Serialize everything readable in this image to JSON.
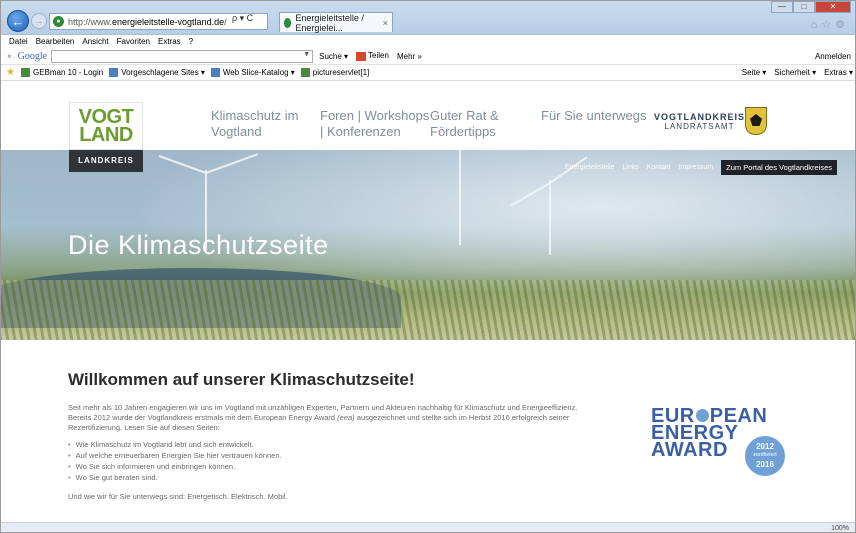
{
  "browser": {
    "url_prefix": "http://www.",
    "url_domain": "energieleitstelle-vogtland.de",
    "url_suffix": "/",
    "addr_tools": "ρ ▾ C",
    "tab_title": "Energieleitstelle / Energielei...",
    "tab_close": "×",
    "menu": [
      "Datei",
      "Bearbeiten",
      "Ansicht",
      "Favoriten",
      "Extras",
      "?"
    ],
    "search_provider": "Google",
    "search_button": "Suche ▾",
    "share_button": "Teilen",
    "more_button": "Mehr »",
    "signin": "Anmelden",
    "favorites": [
      "GEBman 10 - Login",
      "Vorgeschlagene Sites ▾",
      "Web Slice-Katalog ▾",
      "pictureservlet[1]"
    ],
    "command_bar": [
      "Seite ▾",
      "Sicherheit ▾",
      "Extras ▾"
    ],
    "zoom": "100%"
  },
  "site": {
    "logo_line1": "VOGT",
    "logo_line2": "LAND",
    "logo_sub": "LANDKREIS",
    "nav": [
      {
        "line1": "Klimaschutz im",
        "line2": "Vogtland"
      },
      {
        "line1": "Foren | Workshops",
        "line2": "| Konferenzen"
      },
      {
        "line1": "Guter Rat &",
        "line2": "Fördertipps"
      },
      {
        "line1": "Für Sie unterwegs",
        "line2": ""
      }
    ],
    "authority_line1": "VOGTLANDKREIS",
    "authority_line2": "LANDRATSAMT"
  },
  "hero": {
    "title": "Die Klimaschutzseite",
    "subnav": [
      "Energieleitstelle",
      "Links",
      "Kontakt",
      "Impressum"
    ],
    "portal_button": "Zum Portal des Vogtlandkreises"
  },
  "content": {
    "heading": "Willkommen auf unserer Klimaschutzseite!",
    "intro_1": "Seit mehr als 10 Jahren engagieren wir uns im Vogtland mit unzähligen Experten, Partnern und Akteuren nachhaltig für Klimaschutz und Energieeffizienz.",
    "intro_2a": "Bereits 2012 wurde der Vogtlandkreis erstmals mit dem European Energy Award ",
    "intro_2b": "(eea)",
    "intro_2c": " ausgezeichnet und stellte sich im Herbst 2016 erfolgreich seiner",
    "intro_3": "Rezertifizierung. Lesen Sie auf diesen Seiten:",
    "bullets": [
      "Wie Klimaschutz im Vogtland lebt und sich entwickelt.",
      "Auf welche erneuerbaren Energien Sie hier vertrauen können.",
      "Wo Sie sich informieren und einbringen können.",
      "Wo Sie gut beraten sind."
    ],
    "closing": "Und wie wir für Sie unterwegs sind: Energetisch. Elektrisch. Mobil.",
    "award": {
      "w1a": "EUR",
      "w1b": "PEAN",
      "w2": "ENERGY",
      "w3": "AWARD",
      "badge_year1": "2012",
      "badge_text": "zertifiziert",
      "badge_year2": "2016"
    }
  },
  "colors": {
    "accent_green": "#6c9b2f",
    "award_blue": "#3c5fa4",
    "dark": "#2f3438"
  }
}
